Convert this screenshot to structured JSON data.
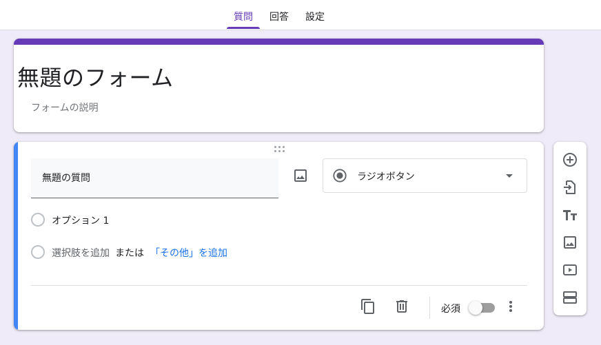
{
  "tabs": [
    {
      "label": "質問",
      "active": true
    },
    {
      "label": "回答",
      "active": false
    },
    {
      "label": "設定",
      "active": false
    }
  ],
  "form": {
    "title": "無題のフォーム",
    "description": "フォームの説明"
  },
  "question": {
    "title": "無題の質問",
    "type_label": "ラジオボタン",
    "options": [
      {
        "label": "オプション 1"
      }
    ],
    "add_option_label": "選択肢を追加",
    "or_label": "または",
    "add_other_label": "「その他」を追加",
    "required_label": "必須",
    "required": false
  },
  "icons": {
    "image": "image-icon",
    "radio": "radio-button-checked-icon",
    "dropdown": "arrow-drop-down-icon",
    "copy": "content-copy-icon",
    "delete": "trash-icon",
    "more": "more-vert-icon",
    "add_question": "add-circle-icon",
    "import": "import-questions-icon",
    "title": "title-text-icon",
    "add_image": "image-icon",
    "add_video": "video-icon",
    "add_section": "section-icon"
  },
  "colors": {
    "accent": "#673ab7",
    "background": "#f0ebf8",
    "focus_bar": "#4285f4",
    "link": "#1a73e8"
  }
}
